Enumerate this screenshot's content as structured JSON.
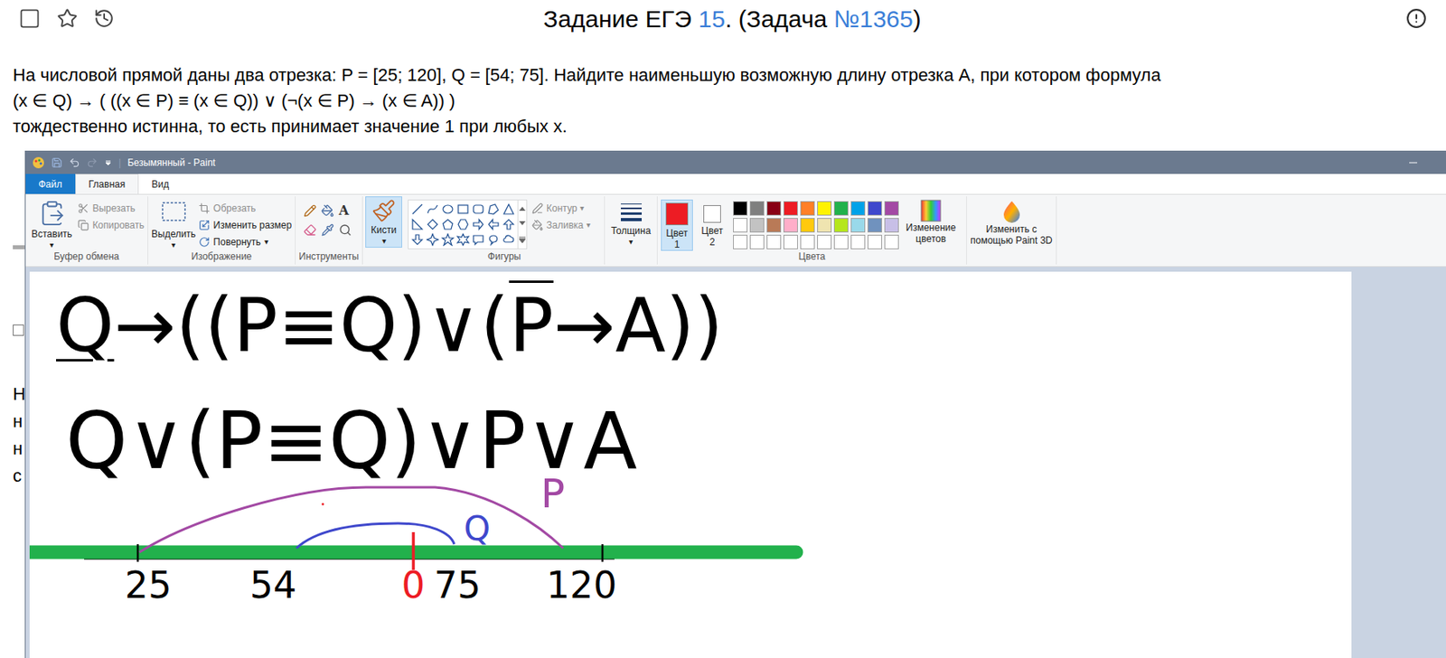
{
  "page": {
    "title": [
      {
        "text": "Задание ЕГЭ ",
        "link": false
      },
      {
        "text": "15",
        "link": true
      },
      {
        "text": ". (Задача ",
        "link": false
      },
      {
        "text": "№1365",
        "link": true
      },
      {
        "text": ")",
        "link": false
      }
    ],
    "bookmarked": false,
    "starred": false,
    "problem": [
      "На числовой прямой даны два отрезка: P = [25; 120], Q = [54; 75]. Найдите наименьшую возможную длину отрезка A, при котором формула",
      "(x ∈ Q) → ( ((x ∈ P) ≡ (x ∈ Q)) ∨ (¬(x ∈ P) → (x ∈ A)) )",
      "тождественно истинна, то есть принимает значение 1 при любых x."
    ],
    "background_fragments": [
      "Н",
      "н",
      "н",
      "с"
    ]
  },
  "paint": {
    "title": "Безымянный - Paint",
    "tabs": [
      {
        "label": "Файл",
        "selected": false,
        "kind": "file"
      },
      {
        "label": "Главная",
        "selected": true,
        "kind": "tab"
      },
      {
        "label": "Вид",
        "selected": false,
        "kind": "tab"
      }
    ],
    "dropdown_glyph": "▾",
    "clipboard": {
      "label": "Буфер обмена",
      "paste": "Вставить",
      "cut": {
        "label": "Вырезать",
        "disabled": true
      },
      "copy": {
        "label": "Копировать",
        "disabled": true
      }
    },
    "image": {
      "label": "Изображение",
      "select": "Выделить",
      "crop": {
        "label": "Обрезать",
        "disabled": true
      },
      "resize": {
        "label": "Изменить размер",
        "disabled": false
      },
      "rotate": {
        "label": "Повернуть",
        "disabled": false
      }
    },
    "tools": {
      "label": "Инструменты",
      "text_glyph": "A"
    },
    "brushes": {
      "label": "Кисти",
      "selected": true
    },
    "shapes": {
      "label": "Фигуры",
      "outline": {
        "label": "Контур",
        "disabled": true
      },
      "fill": {
        "label": "Заливка",
        "disabled": true
      }
    },
    "thickness": {
      "label": "Толщина"
    },
    "colors": {
      "label": "Цвета",
      "color1": {
        "lines": [
          "Цвет",
          "1"
        ],
        "color": "#ed1c24",
        "selected": true
      },
      "color2": {
        "lines": [
          "Цвет",
          "2"
        ],
        "color": "#ffffff",
        "selected": false
      },
      "palette": [
        {
          "color": "#000000"
        },
        {
          "color": "#7f7f7f"
        },
        {
          "color": "#880015"
        },
        {
          "color": "#ed1c24"
        },
        {
          "color": "#ff7f27"
        },
        {
          "color": "#fff200"
        },
        {
          "color": "#22b14c"
        },
        {
          "color": "#00a2e8"
        },
        {
          "color": "#3f48cc"
        },
        {
          "color": "#a349a4"
        },
        {
          "color": "#ffffff"
        },
        {
          "color": "#c3c3c3"
        },
        {
          "color": "#b97a57"
        },
        {
          "color": "#ffaec9"
        },
        {
          "color": "#ffc90e"
        },
        {
          "color": "#efe4b0"
        },
        {
          "color": "#b5e61d"
        },
        {
          "color": "#99d9ea"
        },
        {
          "color": "#7092be"
        },
        {
          "color": "#c8bfe7"
        },
        {
          "color": "#ffffff"
        },
        {
          "color": "#ffffff"
        },
        {
          "color": "#ffffff"
        },
        {
          "color": "#ffffff"
        },
        {
          "color": "#ffffff"
        },
        {
          "color": "#ffffff"
        },
        {
          "color": "#ffffff"
        },
        {
          "color": "#ffffff"
        },
        {
          "color": "#ffffff"
        },
        {
          "color": "#ffffff"
        }
      ],
      "edit": [
        "Изменение",
        "цветов"
      ]
    },
    "paint3d": [
      "Изменить с",
      "помощью Paint 3D"
    ],
    "canvas": {
      "formula1": [
        {
          "text": "Q",
          "underline": true,
          "overline": false
        },
        {
          "text": "→((P≡Q)∨(",
          "underline": false,
          "overline": false
        },
        {
          "text": "P",
          "underline": false,
          "overline": true
        },
        {
          "text": "→A))",
          "underline": false,
          "overline": false
        }
      ],
      "formula2": [
        {
          "text": "Q∨(P≡Q)∨P∨A",
          "underline": false,
          "overline": false
        }
      ],
      "ticks": [
        {
          "label": "25",
          "color": "#000000"
        },
        {
          "label": "54",
          "color": "#000000"
        },
        {
          "label": "0",
          "color": "#ed1c24"
        },
        {
          "label": "75",
          "color": "#000000"
        },
        {
          "label": "120",
          "color": "#000000"
        }
      ],
      "segments": [
        {
          "label": "P",
          "color": "#a349a4"
        },
        {
          "label": "Q",
          "color": "#3f48cc"
        }
      ]
    }
  }
}
